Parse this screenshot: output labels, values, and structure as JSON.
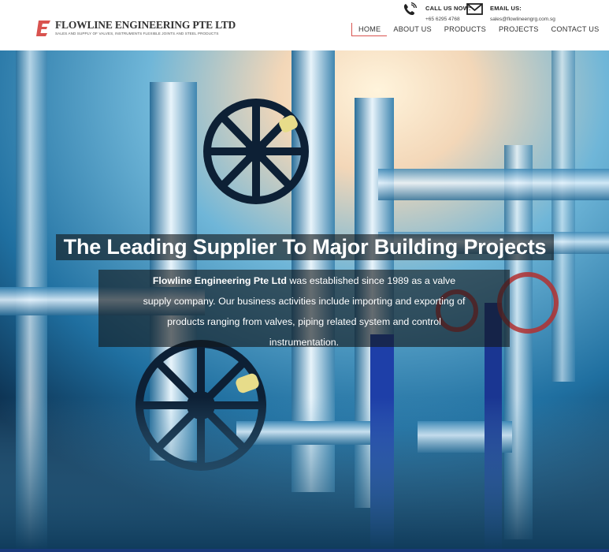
{
  "brand": {
    "logo_letter": "E",
    "name": "FLOWLINE ENGINEERING PTE LTD",
    "tagline": "SALES AND SUPPLY OF VALVES, INSTRUMENTS FLEXIBLE JOINTS AND STEEL PRODUCTS",
    "accent_color": "#d9534f"
  },
  "contact": {
    "phone_label": "CALL US NOW:",
    "phone_value": "+65 6295 4768",
    "phone_icon": "phone-icon",
    "email_label": "EMAIL US:",
    "email_value": "sales@flowlineengrg.com.sg",
    "email_icon": "envelope-icon"
  },
  "nav": {
    "items": [
      {
        "label": "HOME",
        "active": true
      },
      {
        "label": "ABOUT US",
        "active": false
      },
      {
        "label": "PRODUCTS",
        "active": false
      },
      {
        "label": "PROJECTS",
        "active": false
      },
      {
        "label": "CONTACT US",
        "active": false
      }
    ]
  },
  "hero": {
    "headline": "The Leading Supplier To Major Building Projects",
    "intro_company": "Flowline Engineering Pte Ltd",
    "intro_text": " was established since 1989 as a valve supply company. Our business activities include importing and exporting of products ranging from valves, piping related system and control instrumentation."
  }
}
